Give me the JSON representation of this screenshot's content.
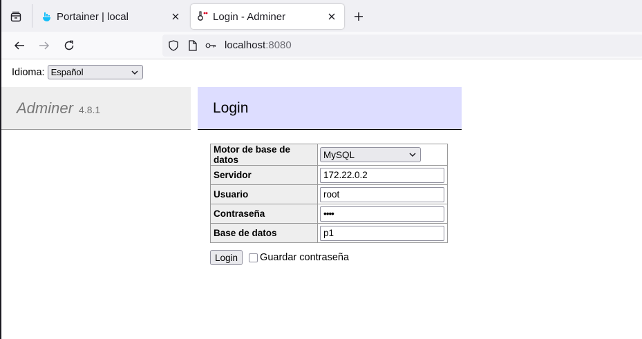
{
  "browser": {
    "tabs": [
      {
        "title": "Portainer | local",
        "icon": "portainer-whale-icon",
        "active": false
      },
      {
        "title": "Login - Adminer",
        "icon": "adminer-icon",
        "active": true
      }
    ],
    "url": {
      "host": "localhost",
      "port": ":8080"
    }
  },
  "page": {
    "language": {
      "label": "Idioma:",
      "value": "Español"
    },
    "app": {
      "name": "Adminer",
      "version": "4.8.1"
    },
    "heading": "Login",
    "form": {
      "rows": [
        {
          "label": "Motor de base de datos",
          "value": "MySQL",
          "kind": "select"
        },
        {
          "label": "Servidor",
          "value": "172.22.0.2",
          "kind": "text"
        },
        {
          "label": "Usuario",
          "value": "root",
          "kind": "text"
        },
        {
          "label": "Contraseña",
          "value": "••••",
          "kind": "password"
        },
        {
          "label": "Base de datos",
          "value": "p1",
          "kind": "text"
        }
      ],
      "submit_label": "Login",
      "remember_label": "Guardar contraseña",
      "remember_checked": false
    }
  },
  "colors": {
    "heading_bg": "#ddddff",
    "menu_bg": "#eeeeee",
    "portainer_blue": "#13bef9"
  }
}
